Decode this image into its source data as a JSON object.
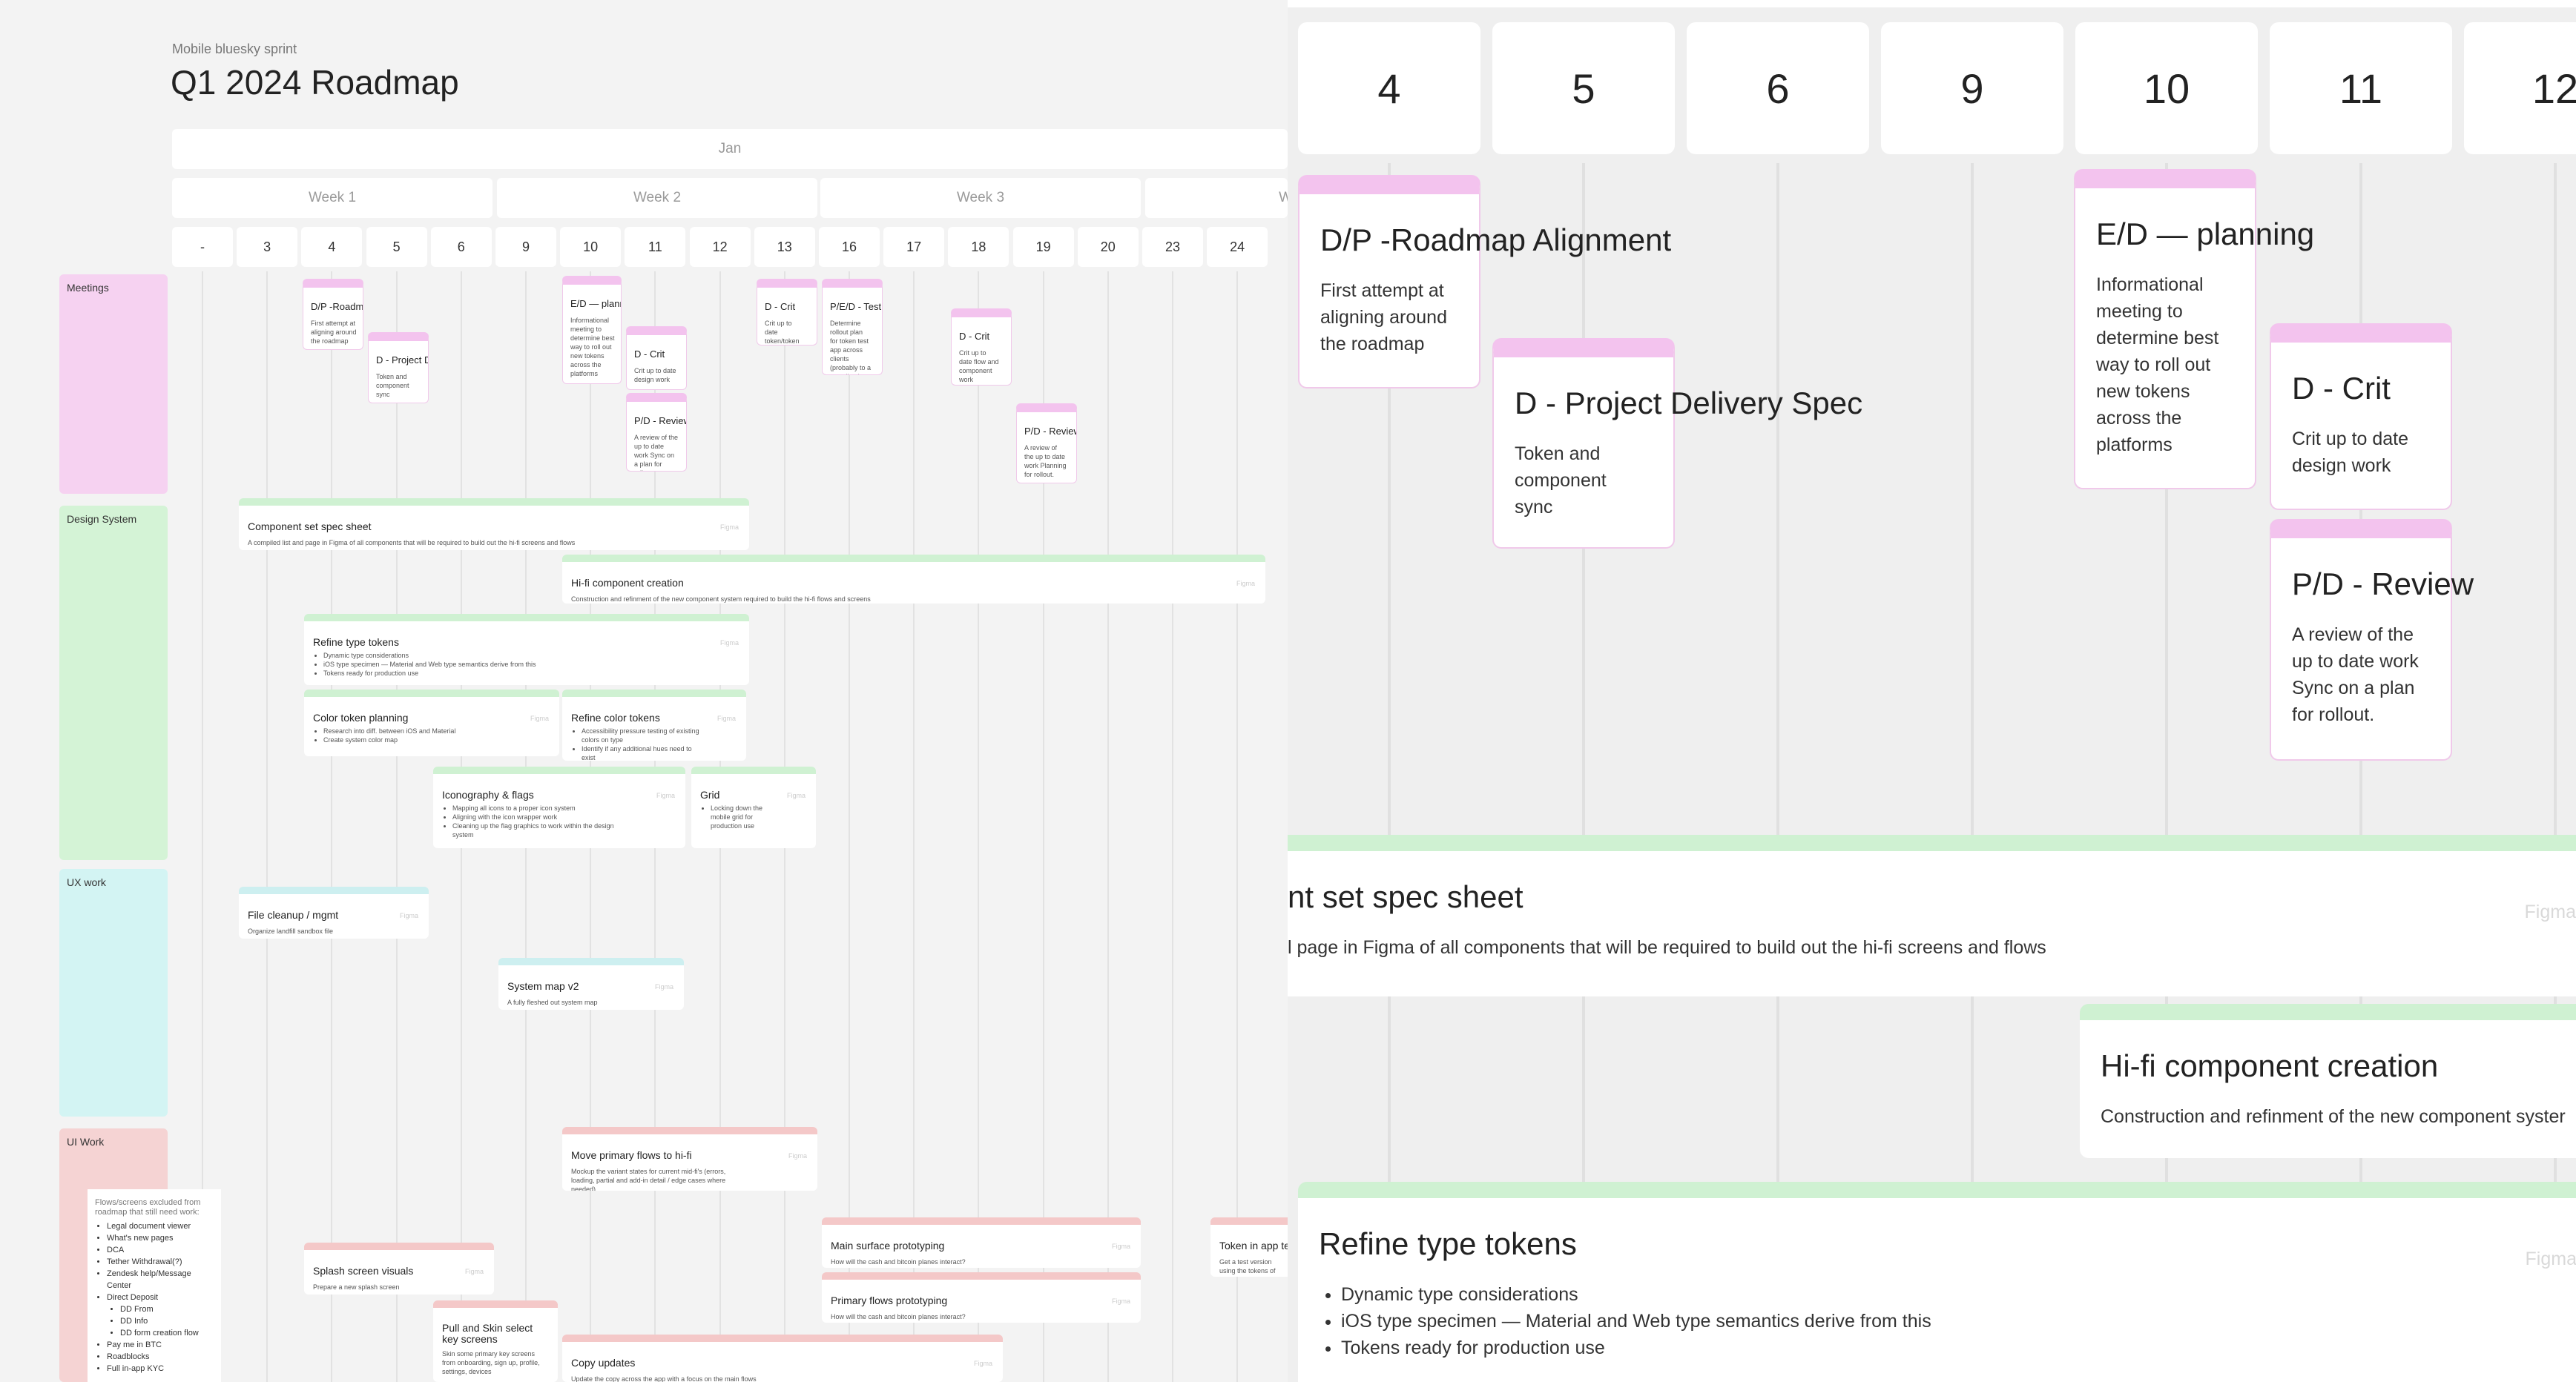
{
  "board": {
    "project": "Mobile bluesky sprint",
    "title": "Q1 2024 Roadmap",
    "month": "Jan",
    "weeks": [
      "Week 1",
      "Week 2",
      "Week 3",
      "W"
    ],
    "days": [
      "-",
      "3",
      "4",
      "5",
      "6",
      "9",
      "10",
      "11",
      "12",
      "13",
      "16",
      "17",
      "18",
      "19",
      "20",
      "23",
      "24"
    ]
  },
  "lanes": {
    "meetings": "Meetings",
    "design_system": "Design System",
    "ux_work": "UX work",
    "ui_work": "UI Work"
  },
  "meetings": {
    "roadmap": {
      "title": "D/P -Roadmap Alignment",
      "desc": "First attempt at aligning around the roadmap"
    },
    "delivery": {
      "title": "D - Project Delivery Spec",
      "desc": "Token and component sync"
    },
    "planning": {
      "title": "E/D — planning",
      "desc": "Informational meeting to determine best way to roll out new tokens across the platforms"
    },
    "crit1": {
      "title": "D - Crit",
      "desc": "Crit up to date design work"
    },
    "review1": {
      "title": "P/D - Review",
      "desc": "A review of the up to date work Sync on a plan for rollout."
    },
    "crit2": {
      "title": "D - Crit",
      "desc": "Crit up to date token/token work"
    },
    "test_rollout": {
      "title": "P/E/D - Test app rollout alignment",
      "desc": "Determine rollout plan for token test app across clients (probably to a test client)"
    },
    "crit3": {
      "title": "D - Crit",
      "desc": "Crit up to date flow and component work"
    },
    "review2": {
      "title": "P/D - Review",
      "desc": "A review of the up to date work Planning for rollout."
    }
  },
  "design_tasks": {
    "spec_sheet": {
      "title": "Component set spec sheet",
      "desc": "A compiled list and page in Figma of all components that will be required to build out the hi-fi screens and flows",
      "tag": "Figma"
    },
    "hifi": {
      "title": "Hi-fi component creation",
      "desc": "Construction and refinment of the new component system required to build the hi-fi flows and screens",
      "tag": "Figma"
    },
    "type_tokens": {
      "title": "Refine type tokens",
      "items": [
        "Dynamic type considerations",
        "iOS type specimen — Material and Web type semantics derive from this",
        "Tokens ready for production use"
      ],
      "tag": "Figma"
    },
    "color_planning": {
      "title": "Color token planning",
      "items": [
        "Research into diff. between iOS and Material",
        "Create system color map"
      ],
      "tag": "Figma"
    },
    "color_refine": {
      "title": "Refine color tokens",
      "items": [
        "Accessibility pressure testing of existing colors on type",
        "Identify if any additional hues need to exist"
      ],
      "tag": "Figma"
    },
    "iconography": {
      "title": "Iconography & flags",
      "items": [
        "Mapping all icons to a proper icon system",
        "Aligning with the icon wrapper work",
        "Cleaning up the flag graphics to work within the design system"
      ],
      "tag": "Figma"
    },
    "grid": {
      "title": "Grid",
      "items": [
        "Locking down the mobile grid for production use"
      ],
      "tag": "Figma"
    }
  },
  "ux_tasks": {
    "cleanup": {
      "title": "File cleanup / mgmt",
      "desc": "Organize landfill sandbox file",
      "tag": "Figma"
    },
    "sysmap": {
      "title": "System map v2",
      "desc": "A fully fleshed out system map",
      "tag": "Figma"
    }
  },
  "ui_tasks": {
    "move_flows": {
      "title": "Move primary flows to hi-fi",
      "desc": "Mockup the variant states for current mid-fi's (errors, loading, partial and add-in detail / edge cases where needed)",
      "tag": "Figma"
    },
    "main_proto": {
      "title": "Main surface prototyping",
      "desc": "How will the cash and bitcoin planes interact?",
      "tag": "Figma"
    },
    "splash": {
      "title": "Splash screen visuals",
      "desc": "Prepare a new splash screen",
      "tag": "Figma"
    },
    "primary_proto": {
      "title": "Primary flows prototyping",
      "desc": "How will the cash and bitcoin planes interact?",
      "tag": "Figma"
    },
    "token_test": {
      "title": "Token in app te",
      "desc": "Get a test version using the tokens of the app?"
    },
    "pull_skin": {
      "title": "Pull and Skin select key screens",
      "desc": "Skin some primary key screens from onboarding, sign up, profile, settings, devices"
    },
    "copy": {
      "title": "Copy updates",
      "desc": "Update the copy across the app with a focus on the main flows",
      "tag": "Figma"
    }
  },
  "note": {
    "intro": "Flows/screens excluded from roadmap that still need work:",
    "items": [
      "Legal document viewer",
      "What's new pages",
      "DCA",
      "Tether Withdrawal(?)",
      "Zendesk help/Message Center",
      "Direct Deposit",
      "DD From",
      "DD Info",
      "DD form creation flow",
      "Pay me in BTC",
      "Roadblocks",
      "Full in-app KYC"
    ]
  },
  "zoom": {
    "days": [
      "4",
      "5",
      "6",
      "9",
      "10",
      "11",
      "12"
    ],
    "spec_title": "nt set spec sheet",
    "spec_desc": "l page in Figma of all components that will be required to build out the hi-fi screens and flows",
    "hifi_desc": "Construction and refinment of the new component syster"
  },
  "colors": {
    "meetings": "#f6d2f1",
    "design_system": "#d4f3d6",
    "ux_work": "#d3f4f3",
    "ui_work": "#f5d3d3"
  }
}
